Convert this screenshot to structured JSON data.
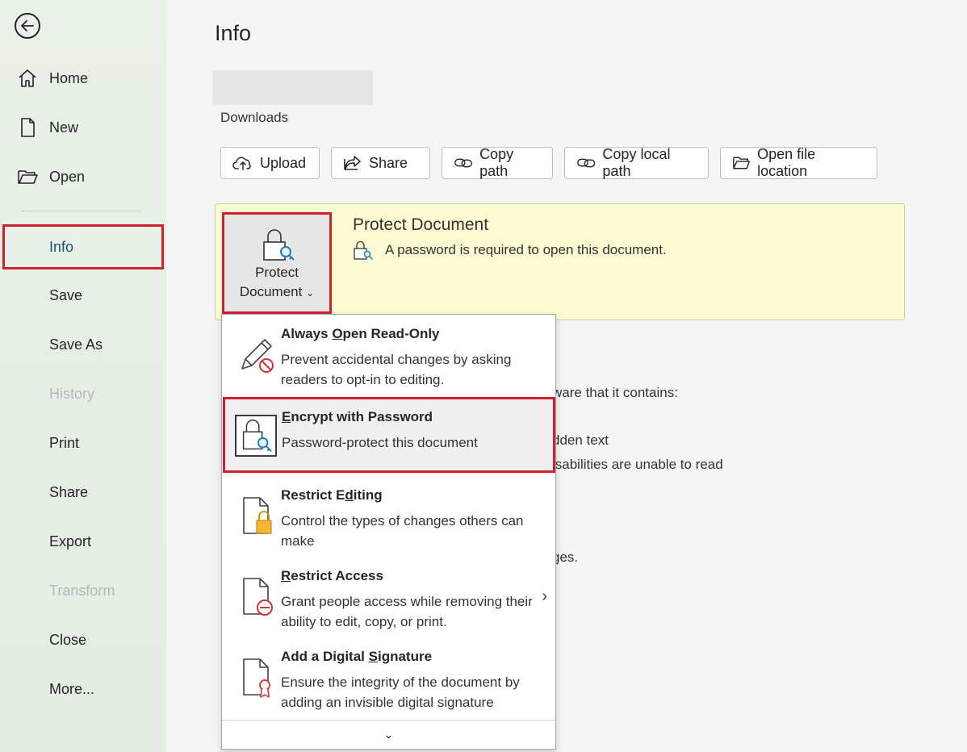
{
  "sidebar": {
    "back_icon": "arrow-left-icon",
    "items": [
      {
        "label": "Home",
        "icon": "home-icon"
      },
      {
        "label": "New",
        "icon": "new-document-icon"
      },
      {
        "label": "Open",
        "icon": "folder-open-icon"
      },
      {
        "label": "Info"
      },
      {
        "label": "Save"
      },
      {
        "label": "Save As"
      },
      {
        "label": "History",
        "disabled": true
      },
      {
        "label": "Print"
      },
      {
        "label": "Share"
      },
      {
        "label": "Export"
      },
      {
        "label": "Transform",
        "disabled": true
      },
      {
        "label": "Close"
      },
      {
        "label": "More..."
      }
    ],
    "active_item": "Info"
  },
  "main": {
    "title": "Info",
    "file_location": "Downloads",
    "actions": [
      {
        "label": "Upload",
        "icon": "cloud-upload-icon"
      },
      {
        "label": "Share",
        "icon": "share-icon"
      },
      {
        "label": "Copy path",
        "icon": "link-icon"
      },
      {
        "label": "Copy local path",
        "icon": "link-icon"
      },
      {
        "label": "Open file location",
        "icon": "folder-open-icon"
      }
    ],
    "protect": {
      "button_line1": "Protect",
      "button_line2": "Document",
      "title": "Protect Document",
      "description": "A password is required to open this document."
    },
    "background_text": {
      "line1": "ware that it contains:",
      "line2": "dden text",
      "line3": "isabilities are unable to read",
      "line4": "ges."
    }
  },
  "menu": {
    "items": [
      {
        "title_pre": "Always ",
        "title_u": "O",
        "title_post": "pen Read-Only",
        "desc": "Prevent accidental changes by asking readers to opt-in to editing.",
        "icon": "pencil-prohibited-icon"
      },
      {
        "title_pre": "",
        "title_u": "E",
        "title_post": "ncrypt with Password",
        "desc": "Password-protect this document",
        "icon": "lock-key-icon"
      },
      {
        "title_pre": "Restrict E",
        "title_u": "d",
        "title_post": "iting",
        "desc": "Control the types of changes others can make",
        "icon": "document-lock-icon"
      },
      {
        "title_pre": "",
        "title_u": "R",
        "title_post": "estrict Access",
        "desc": "Grant people access while removing their ability to edit, copy, or print.",
        "icon": "document-restricted-icon"
      },
      {
        "title_pre": "Add a Digital ",
        "title_u": "S",
        "title_post": "ignature",
        "desc": "Ensure the integrity of the document by adding an invisible digital signature",
        "icon": "document-ribbon-icon"
      }
    ],
    "footer": "⌄"
  }
}
